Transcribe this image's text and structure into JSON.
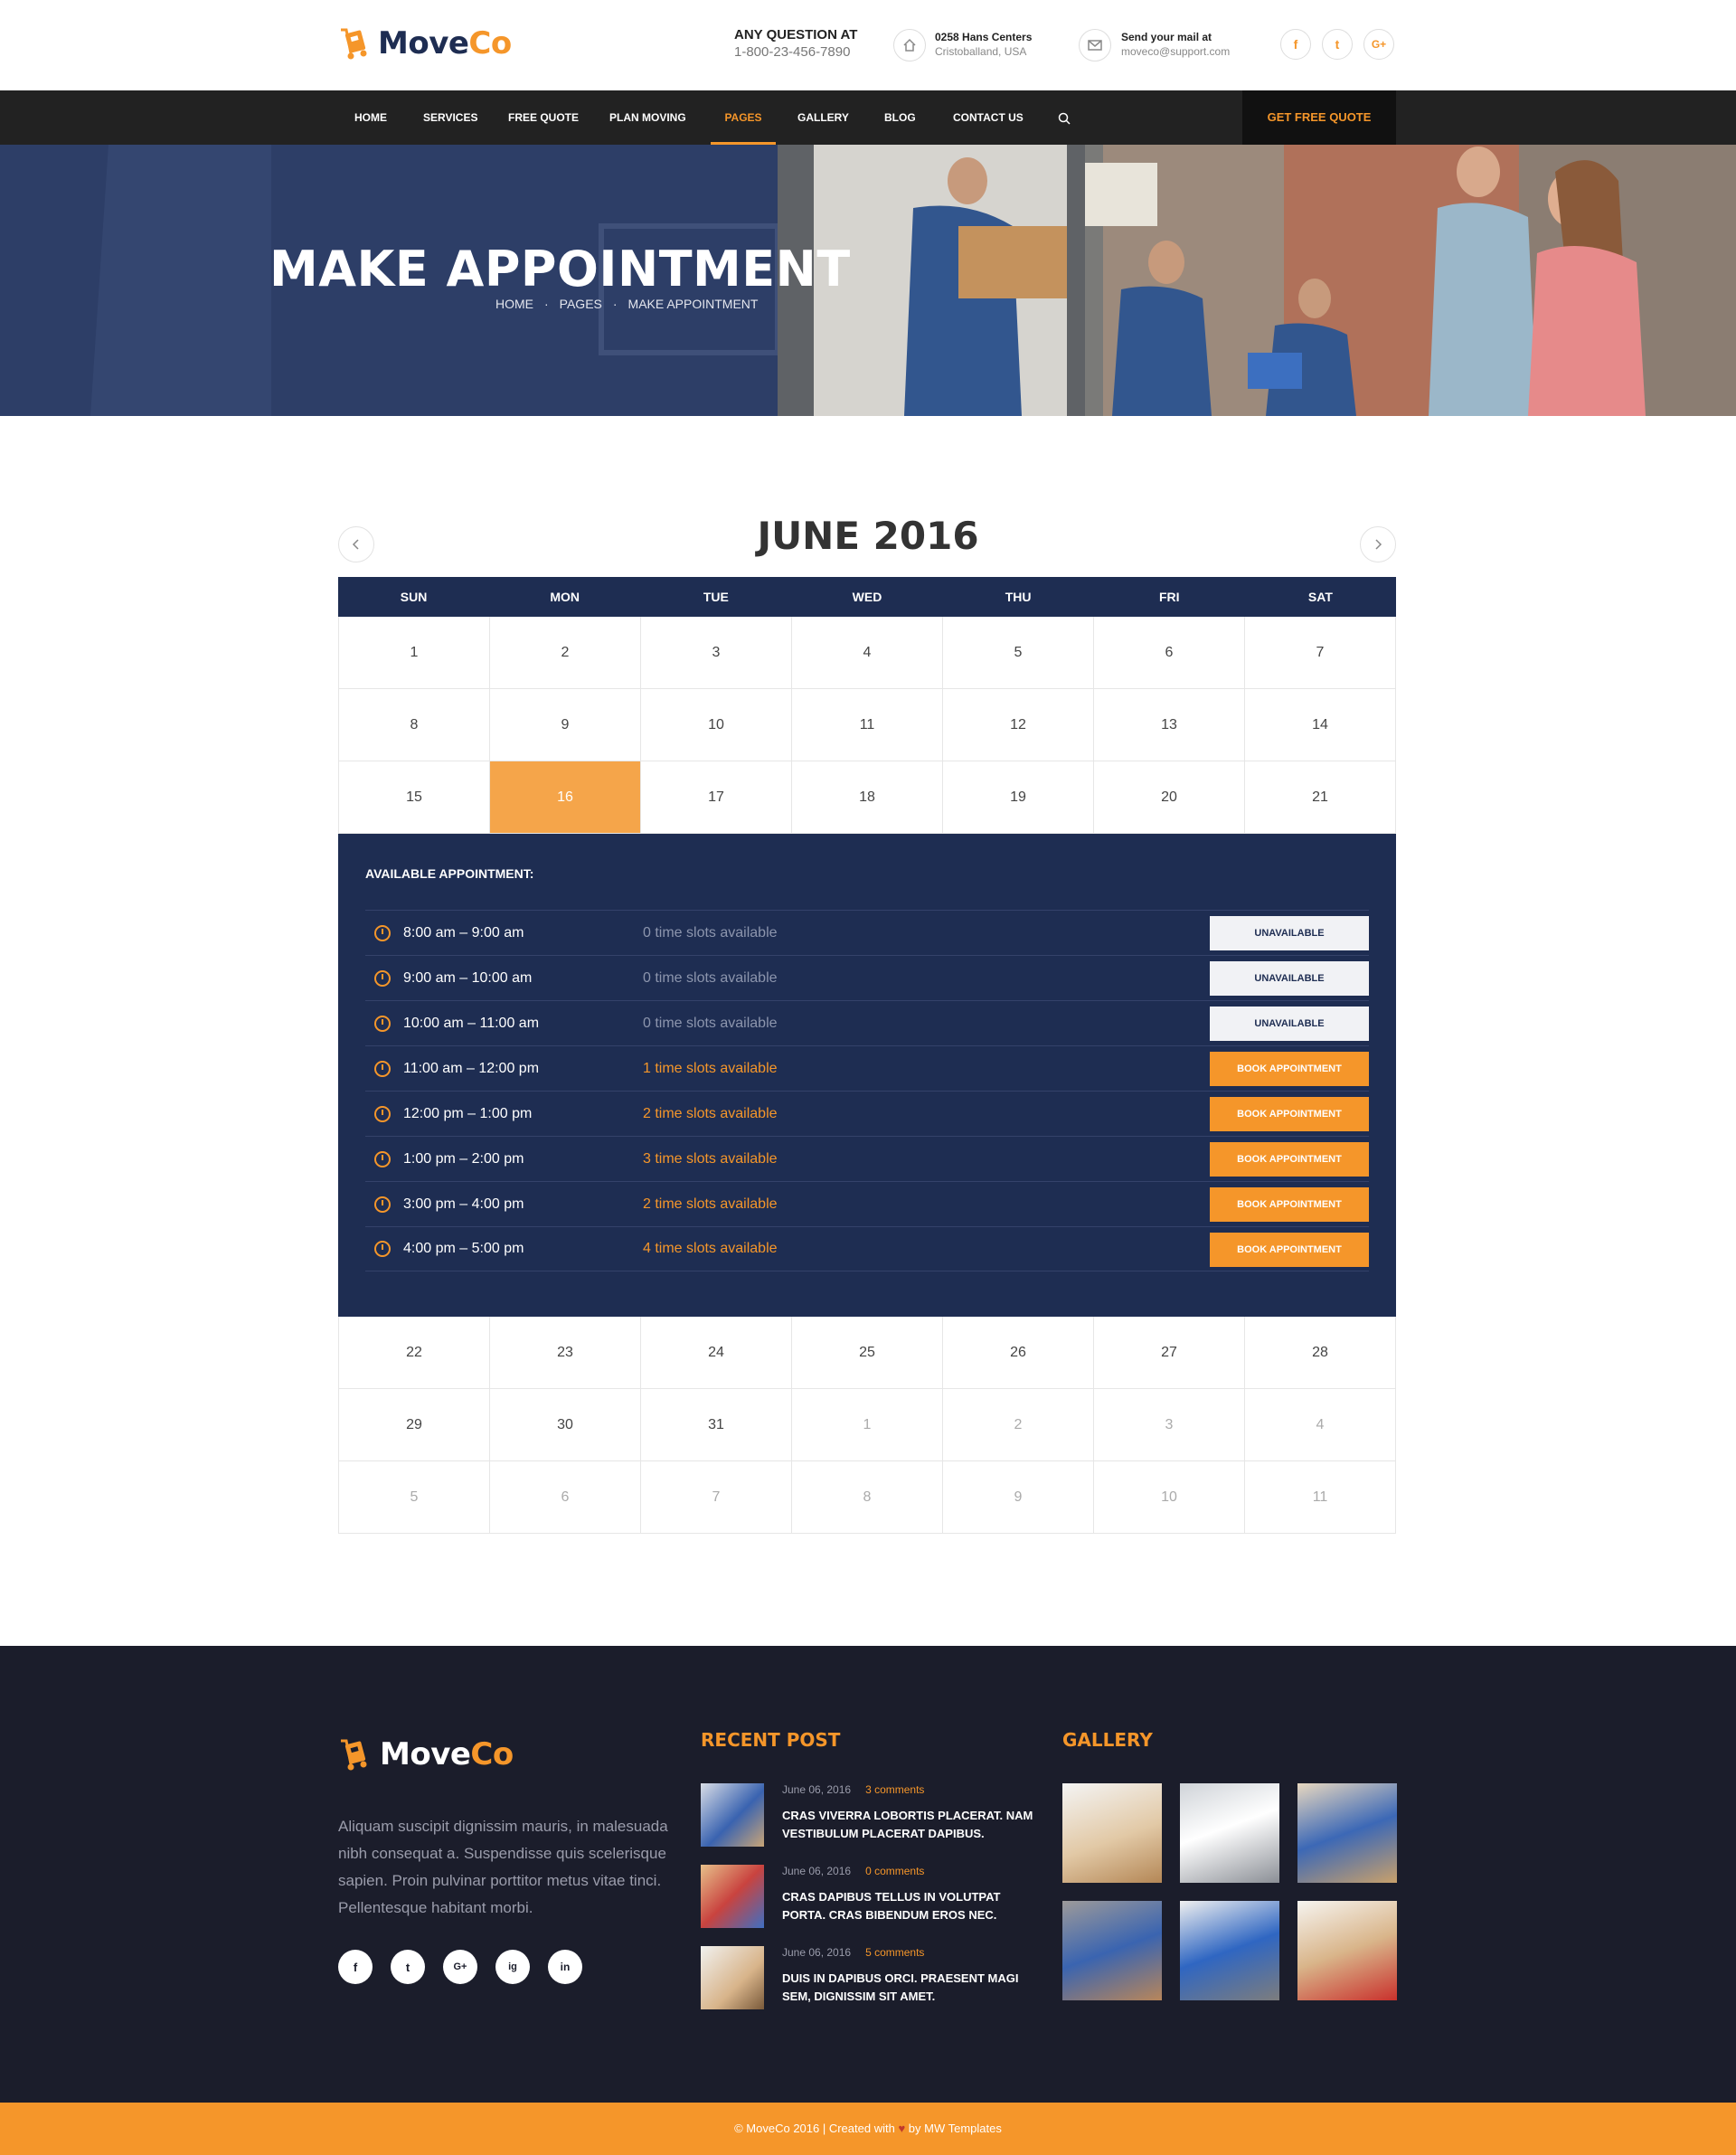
{
  "brand": {
    "name_a": "Move",
    "name_b": "Co"
  },
  "topinfo": {
    "phone_title": "ANY QUESTION AT",
    "phone_value": "1-800-23-456-7890",
    "address_title": "0258 Hans Centers",
    "address_value": "Cristoballand, USA",
    "mail_title": "Send your mail at",
    "mail_value": "moveco@support.com",
    "socials": [
      "f",
      "t",
      "G+"
    ]
  },
  "nav": {
    "items": [
      "HOME",
      "SERVICES",
      "FREE QUOTE",
      "PLAN MOVING",
      "PAGES",
      "GALLERY",
      "BLOG",
      "CONTACT US"
    ],
    "active": "PAGES",
    "cta": "GET FREE QUOTE"
  },
  "hero": {
    "title": "MAKE APPOINTMENT",
    "breadcrumb": [
      "HOME",
      "PAGES",
      "MAKE APPOINTMENT"
    ]
  },
  "calendar": {
    "month_label": "JUNE 2016",
    "weekdays": [
      "SUN",
      "MON",
      "TUE",
      "WED",
      "THU",
      "FRI",
      "SAT"
    ],
    "weeks_before": [
      [
        "1",
        "2",
        "3",
        "4",
        "5",
        "6",
        "7"
      ],
      [
        "8",
        "9",
        "10",
        "11",
        "12",
        "13",
        "14"
      ],
      [
        "15",
        "16",
        "17",
        "18",
        "19",
        "20",
        "21"
      ]
    ],
    "weeks_after": [
      [
        "22",
        "23",
        "24",
        "25",
        "26",
        "27",
        "28"
      ],
      [
        "29",
        "30",
        "31",
        "1",
        "2",
        "3",
        "4"
      ],
      [
        "5",
        "6",
        "7",
        "8",
        "9",
        "10",
        "11"
      ]
    ],
    "selected_day": "16",
    "appointments_heading": "AVAILABLE APPOINTMENT:",
    "slots": [
      {
        "time": "8:00 am – 9:00 am",
        "avail": "0 time slots available",
        "button": "UNAVAILABLE",
        "open": false
      },
      {
        "time": "9:00 am – 10:00 am",
        "avail": "0 time slots available",
        "button": "UNAVAILABLE",
        "open": false
      },
      {
        "time": "10:00 am – 11:00 am",
        "avail": "0 time slots available",
        "button": "UNAVAILABLE",
        "open": false
      },
      {
        "time": "11:00 am – 12:00 pm",
        "avail": "1 time slots available",
        "button": "BOOK APPOINTMENT",
        "open": true
      },
      {
        "time": "12:00 pm – 1:00 pm",
        "avail": "2 time slots available",
        "button": "BOOK APPOINTMENT",
        "open": true
      },
      {
        "time": "1:00 pm – 2:00 pm",
        "avail": "3 time slots available",
        "button": "BOOK APPOINTMENT",
        "open": true
      },
      {
        "time": "3:00 pm – 4:00 pm",
        "avail": "2 time slots available",
        "button": "BOOK APPOINTMENT",
        "open": true
      },
      {
        "time": "4:00 pm – 5:00 pm",
        "avail": "4 time slots available",
        "button": "BOOK APPOINTMENT",
        "open": true
      }
    ]
  },
  "footer": {
    "about": "Aliquam suscipit dignissim mauris, in malesuada nibh consequat a. Suspendisse quis scelerisque sapien. Proin pulvinar porttitor metus vitae tinci. Pellentesque habitant morbi.",
    "socials": [
      "f",
      "t",
      "G+",
      "ig",
      "in"
    ],
    "recent_heading": "RECENT POST",
    "posts": [
      {
        "date": "June 06, 2016",
        "comments": "3 comments",
        "title": "CRAS VIVERRA LOBORTIS PLACERAT. NAM VESTIBULUM PLACERAT DAPIBUS."
      },
      {
        "date": "June 06, 2016",
        "comments": "0 comments",
        "title": "CRAS DAPIBUS TELLUS IN VOLUTPAT PORTA. CRAS BIBENDUM EROS NEC."
      },
      {
        "date": "June 06, 2016",
        "comments": "5 comments",
        "title": "DUIS IN DAPIBUS ORCI. PRAESENT MAGI SEM, DIGNISSIM SIT AMET."
      }
    ],
    "gallery_heading": "GALLERY",
    "copyright_a": "© MoveCo 2016 | Created with",
    "copyright_b": "by MW Templates"
  },
  "colors": {
    "accent": "#f5962a",
    "navy": "#1e2d52",
    "dark": "#222222",
    "footer": "#1b1d2b"
  }
}
